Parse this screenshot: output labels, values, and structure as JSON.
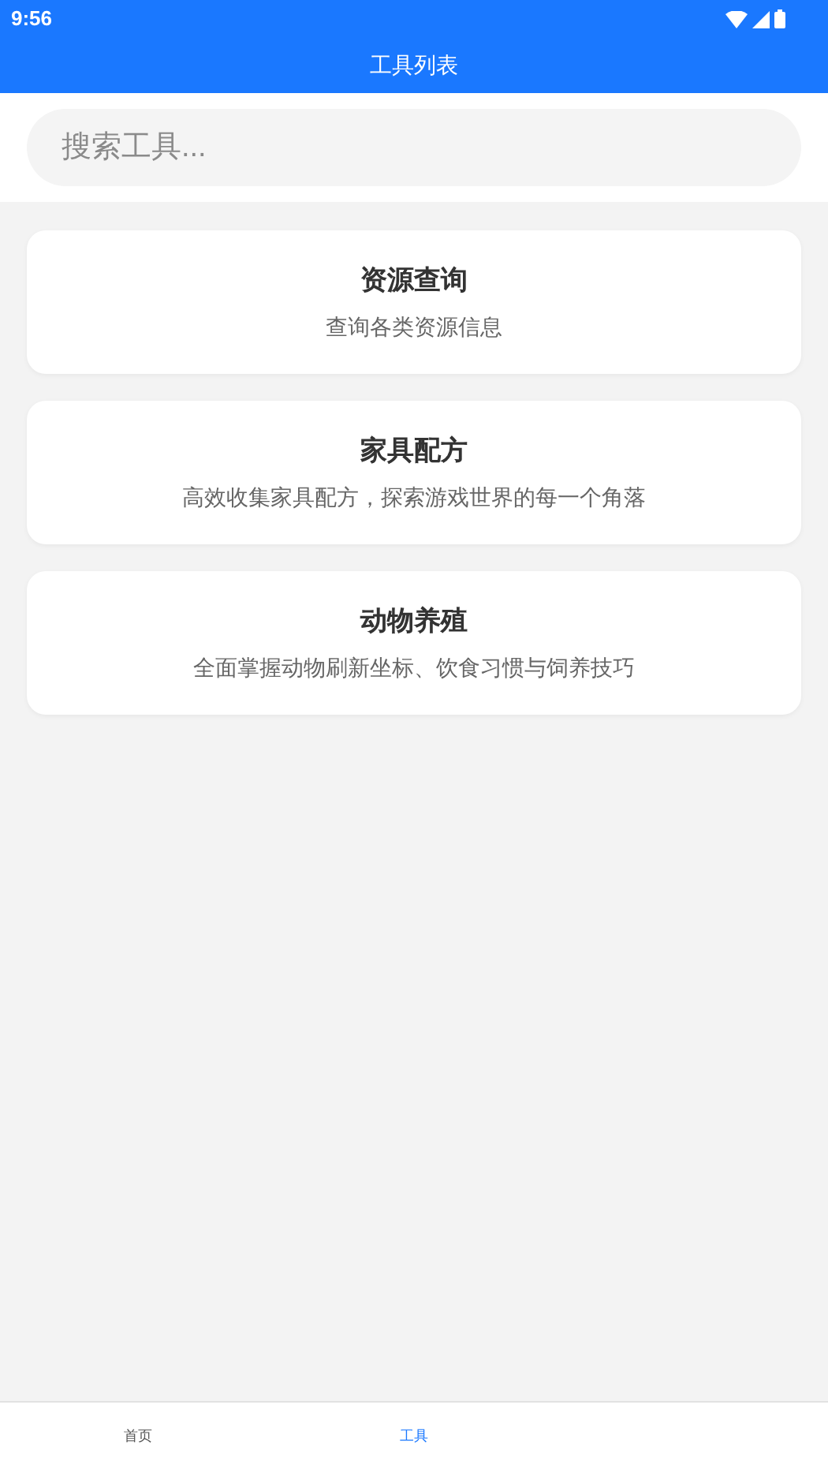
{
  "status_bar": {
    "time": "9:56"
  },
  "app_bar": {
    "title": "工具列表"
  },
  "search": {
    "placeholder": "搜索工具..."
  },
  "tools": [
    {
      "title": "资源查询",
      "description": "查询各类资源信息"
    },
    {
      "title": "家具配方",
      "description": "高效收集家具配方，探索游戏世界的每一个角落"
    },
    {
      "title": "动物养殖",
      "description": "全面掌握动物刷新坐标、饮食习惯与饲养技巧"
    }
  ],
  "bottom_nav": [
    {
      "label": "首页",
      "selected": false
    },
    {
      "label": "工具",
      "selected": true
    }
  ]
}
